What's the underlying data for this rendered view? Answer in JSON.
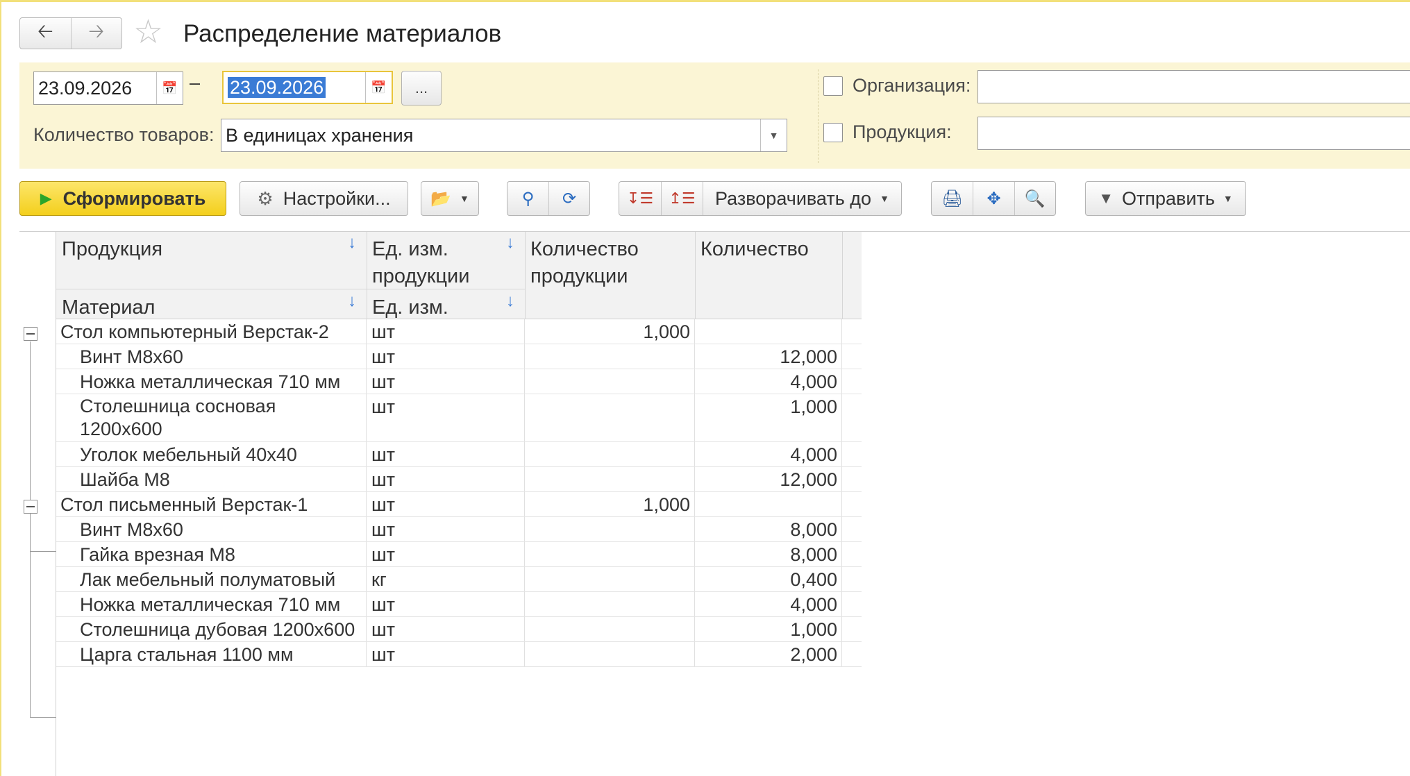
{
  "window": {
    "title": "Распределение материалов",
    "nav": {
      "back_icon": "arrow-left-icon",
      "forward_icon": "arrow-right-icon"
    }
  },
  "filters": {
    "date_from": "23.09.2026",
    "date_to": "23.09.2026",
    "period_button": "...",
    "quantity_label": "Количество товаров:",
    "quantity_value": "В единицах хранения",
    "organization_label": "Организация:",
    "organization_value": "",
    "product_label": "Продукция:",
    "product_value": ""
  },
  "toolbar": {
    "generate_label": "Сформировать",
    "settings_label": "Настройки...",
    "expand_label": "Разворачивать до",
    "send_label": "Отправить"
  },
  "table": {
    "headers": {
      "product": "Продукция",
      "material": "Материал",
      "product_unit": "Ед. изм. продукции",
      "unit": "Ед. изм.",
      "product_qty": "Количество продукции",
      "qty": "Количество"
    },
    "groups": [
      {
        "product": "Стол компьютерный Верстак-2",
        "unit": "шт",
        "product_qty": "1,000",
        "materials": [
          {
            "name": "Винт М8х60",
            "unit": "шт",
            "qty": "12,000"
          },
          {
            "name": "Ножка металлическая 710 мм",
            "unit": "шт",
            "qty": "4,000"
          },
          {
            "name": "Столешница сосновая 1200х600",
            "unit": "шт",
            "qty": "1,000"
          },
          {
            "name": "Уголок мебельный 40х40",
            "unit": "шт",
            "qty": "4,000"
          },
          {
            "name": "Шайба М8",
            "unit": "шт",
            "qty": "12,000"
          }
        ]
      },
      {
        "product": "Стол письменный Верстак-1",
        "unit": "шт",
        "product_qty": "1,000",
        "materials": [
          {
            "name": "Винт М8х60",
            "unit": "шт",
            "qty": "8,000"
          },
          {
            "name": "Гайка врезная М8",
            "unit": "шт",
            "qty": "8,000"
          },
          {
            "name": "Лак мебельный полуматовый",
            "unit": "кг",
            "qty": "0,400"
          },
          {
            "name": "Ножка металлическая 710 мм",
            "unit": "шт",
            "qty": "4,000"
          },
          {
            "name": "Столешница дубовая 1200х600",
            "unit": "шт",
            "qty": "1,000"
          },
          {
            "name": "Царга стальная 1100 мм",
            "unit": "шт",
            "qty": "2,000"
          }
        ]
      }
    ]
  }
}
